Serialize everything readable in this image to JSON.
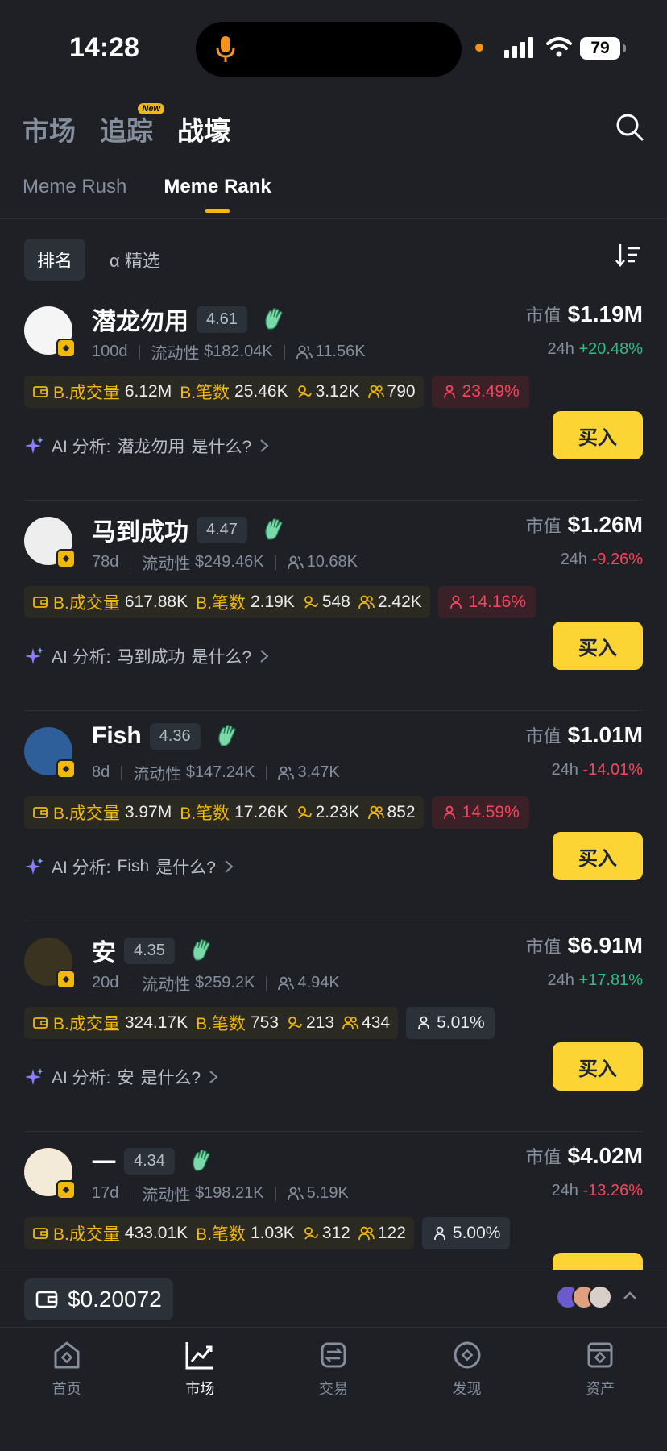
{
  "status_bar": {
    "time": "14:28",
    "battery": "79"
  },
  "header": {
    "tabs": [
      {
        "label": "市场"
      },
      {
        "label": "追踪",
        "badge": "New"
      },
      {
        "label": "战壕"
      }
    ]
  },
  "sub_tabs": [
    {
      "label": "Meme Rush"
    },
    {
      "label": "Meme Rank"
    }
  ],
  "filters": [
    {
      "label": "排名"
    },
    {
      "label": "α 精选"
    }
  ],
  "labels": {
    "mcap": "市值",
    "change_period": "24h",
    "liquidity": "流动性",
    "b_volume": "B.成交量",
    "b_trades": "B.笔数",
    "ai_prefix": "AI 分析:",
    "ai_suffix": "是什么?",
    "buy": "买入"
  },
  "tokens": [
    {
      "name": "潜龙勿用",
      "score": "4.61",
      "age": "100d",
      "liquidity": "$182.04K",
      "holders": "11.56K",
      "mcap": "$1.19M",
      "change": "+20.48%",
      "change_dir": "up",
      "b_volume": "6.12M",
      "b_trades": "25.46K",
      "s1": "3.12K",
      "s2": "790",
      "pct": "23.49%",
      "pct_style": "red",
      "avatar_color": "#f5f5f5"
    },
    {
      "name": "马到成功",
      "score": "4.47",
      "age": "78d",
      "liquidity": "$249.46K",
      "holders": "10.68K",
      "mcap": "$1.26M",
      "change": "-9.26%",
      "change_dir": "down",
      "b_volume": "617.88K",
      "b_trades": "2.19K",
      "s1": "548",
      "s2": "2.42K",
      "pct": "14.16%",
      "pct_style": "red",
      "avatar_color": "#eeeeee"
    },
    {
      "name": "Fish",
      "score": "4.36",
      "age": "8d",
      "liquidity": "$147.24K",
      "holders": "3.47K",
      "mcap": "$1.01M",
      "change": "-14.01%",
      "change_dir": "down",
      "b_volume": "3.97M",
      "b_trades": "17.26K",
      "s1": "2.23K",
      "s2": "852",
      "pct": "14.59%",
      "pct_style": "red",
      "avatar_color": "#2e5f9a"
    },
    {
      "name": "安",
      "score": "4.35",
      "age": "20d",
      "liquidity": "$259.2K",
      "holders": "4.94K",
      "mcap": "$6.91M",
      "change": "+17.81%",
      "change_dir": "up",
      "b_volume": "324.17K",
      "b_trades": "753",
      "s1": "213",
      "s2": "434",
      "pct": "5.01%",
      "pct_style": "gray",
      "avatar_color": "#3a3320"
    },
    {
      "name": "一",
      "score": "4.34",
      "age": "17d",
      "liquidity": "$198.21K",
      "holders": "5.19K",
      "mcap": "$4.02M",
      "change": "-13.26%",
      "change_dir": "down",
      "b_volume": "433.01K",
      "b_trades": "1.03K",
      "s1": "312",
      "s2": "122",
      "pct": "5.00%",
      "pct_style": "gray",
      "avatar_color": "#f3ead8"
    }
  ],
  "wallet": {
    "balance": "$0.20072"
  },
  "bottom_nav": [
    {
      "label": "首页"
    },
    {
      "label": "市场"
    },
    {
      "label": "交易"
    },
    {
      "label": "发现"
    },
    {
      "label": "资产"
    }
  ],
  "colors": {
    "accent": "#fcd535",
    "up": "#2ebd85",
    "down": "#f6465d",
    "bg": "#1e2026"
  }
}
